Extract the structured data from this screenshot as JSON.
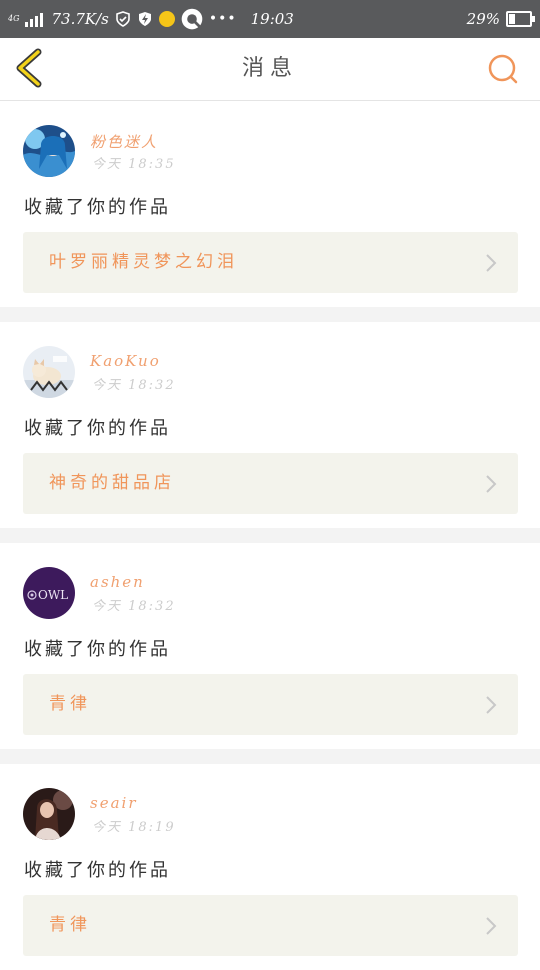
{
  "status_bar": {
    "network_type": "4G",
    "speed": "73.7K/s",
    "time": "19:03",
    "battery_percent": "29%",
    "battery_level": 0.29,
    "overflow": "•••"
  },
  "header": {
    "title": "消息"
  },
  "colors": {
    "accent": "#f0955a",
    "back_arrow": "#f2d21a",
    "status_bar_bg": "#595a5c",
    "work_bg": "#f3f3ec",
    "separator": "#f3f3f3"
  },
  "messages": [
    {
      "user": "粉色迷人",
      "time": "今天 18:35",
      "action": "收藏了你的作品",
      "work_title": "叶罗丽精灵梦之幻泪",
      "avatar_icon": "anime-girl-avatar"
    },
    {
      "user": "KaoKuo",
      "time": "今天 18:32",
      "action": "收藏了你的作品",
      "work_title": "神奇的甜品店",
      "avatar_icon": "cat-avatar"
    },
    {
      "user": "ashen",
      "time": "今天 18:32",
      "action": "收藏了你的作品",
      "work_title": "青律",
      "avatar_icon": "owl-logo-avatar",
      "avatar_text": "OWL"
    },
    {
      "user": "seair",
      "time": "今天 18:19",
      "action": "收藏了你的作品",
      "work_title": "青律",
      "avatar_icon": "portrait-avatar"
    }
  ]
}
